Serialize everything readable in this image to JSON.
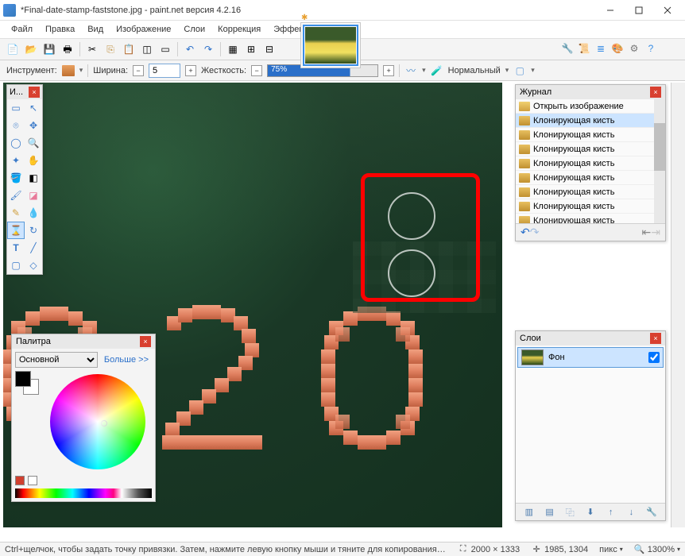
{
  "window": {
    "title": "*Final-date-stamp-faststone.jpg - paint.net версия 4.2.16"
  },
  "menu": {
    "items": [
      "Файл",
      "Правка",
      "Вид",
      "Изображение",
      "Слои",
      "Коррекция",
      "Эффекты"
    ]
  },
  "optbar": {
    "tool_label": "Инструмент:",
    "width_label": "Ширина:",
    "width_value": "5",
    "hardness_label": "Жесткость:",
    "hardness_value": "75%",
    "blend_label": "Нормальный"
  },
  "tools_panel": {
    "title": "И..."
  },
  "palette": {
    "title": "Палитра",
    "select_value": "Основной",
    "more_label": "Больше >>"
  },
  "history": {
    "title": "Журнал",
    "open_label": "Открыть изображение",
    "clone_label": "Клонирующая кисть"
  },
  "layers": {
    "title": "Слои",
    "layer0": "Фон"
  },
  "status": {
    "hint": "Ctrl+щелчок, чтобы задать точку привязки. Затем, нажмите левую кнопку мыши и тяните для копирования изображения вокруг точ...",
    "dims": "2000 × 1333",
    "pos": "1985, 1304",
    "unit": "пикс",
    "zoom": "1300%"
  }
}
